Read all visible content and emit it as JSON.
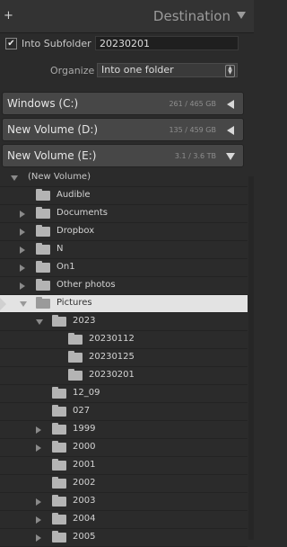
{
  "header": {
    "title": "Destination",
    "add_icon": "plus-icon",
    "collapse_icon": "triangle-down-icon"
  },
  "options": {
    "into_subfolder_label": "Into Subfolder",
    "into_subfolder_checked": true,
    "subfolder_name": "20230201",
    "organize_label": "Organize",
    "organize_value": "Into one folder"
  },
  "volumes": [
    {
      "name": "Windows (C:)",
      "size": "261 / 465 GB",
      "expanded": false
    },
    {
      "name": "New Volume (D:)",
      "size": "135 / 459 GB",
      "expanded": false
    },
    {
      "name": "New Volume (E:)",
      "size": "3.1 / 3.6 TB",
      "expanded": true
    }
  ],
  "volume_root_label": "(New Volume)",
  "tree": [
    {
      "label": "Audible",
      "level": 1,
      "toggle": "none"
    },
    {
      "label": "Documents",
      "level": 1,
      "toggle": "right"
    },
    {
      "label": "Dropbox",
      "level": 1,
      "toggle": "right"
    },
    {
      "label": "N",
      "level": 1,
      "toggle": "right"
    },
    {
      "label": "On1",
      "level": 1,
      "toggle": "right"
    },
    {
      "label": "Other photos",
      "level": 1,
      "toggle": "right"
    },
    {
      "label": "Pictures",
      "level": 1,
      "toggle": "down",
      "selected": true
    },
    {
      "label": "2023",
      "level": 2,
      "toggle": "down"
    },
    {
      "label": "20230112",
      "level": 3,
      "toggle": "none"
    },
    {
      "label": "20230125",
      "level": 3,
      "toggle": "none"
    },
    {
      "label": "20230201",
      "level": 3,
      "toggle": "none"
    },
    {
      "label": "12_09",
      "level": 2,
      "toggle": "none"
    },
    {
      "label": "027",
      "level": 2,
      "toggle": "none"
    },
    {
      "label": "1999",
      "level": 2,
      "toggle": "right"
    },
    {
      "label": "2000",
      "level": 2,
      "toggle": "right"
    },
    {
      "label": "2001",
      "level": 2,
      "toggle": "none"
    },
    {
      "label": "2002",
      "level": 2,
      "toggle": "none"
    },
    {
      "label": "2003",
      "level": 2,
      "toggle": "right"
    },
    {
      "label": "2004",
      "level": 2,
      "toggle": "right"
    },
    {
      "label": "2005",
      "level": 2,
      "toggle": "right"
    }
  ]
}
